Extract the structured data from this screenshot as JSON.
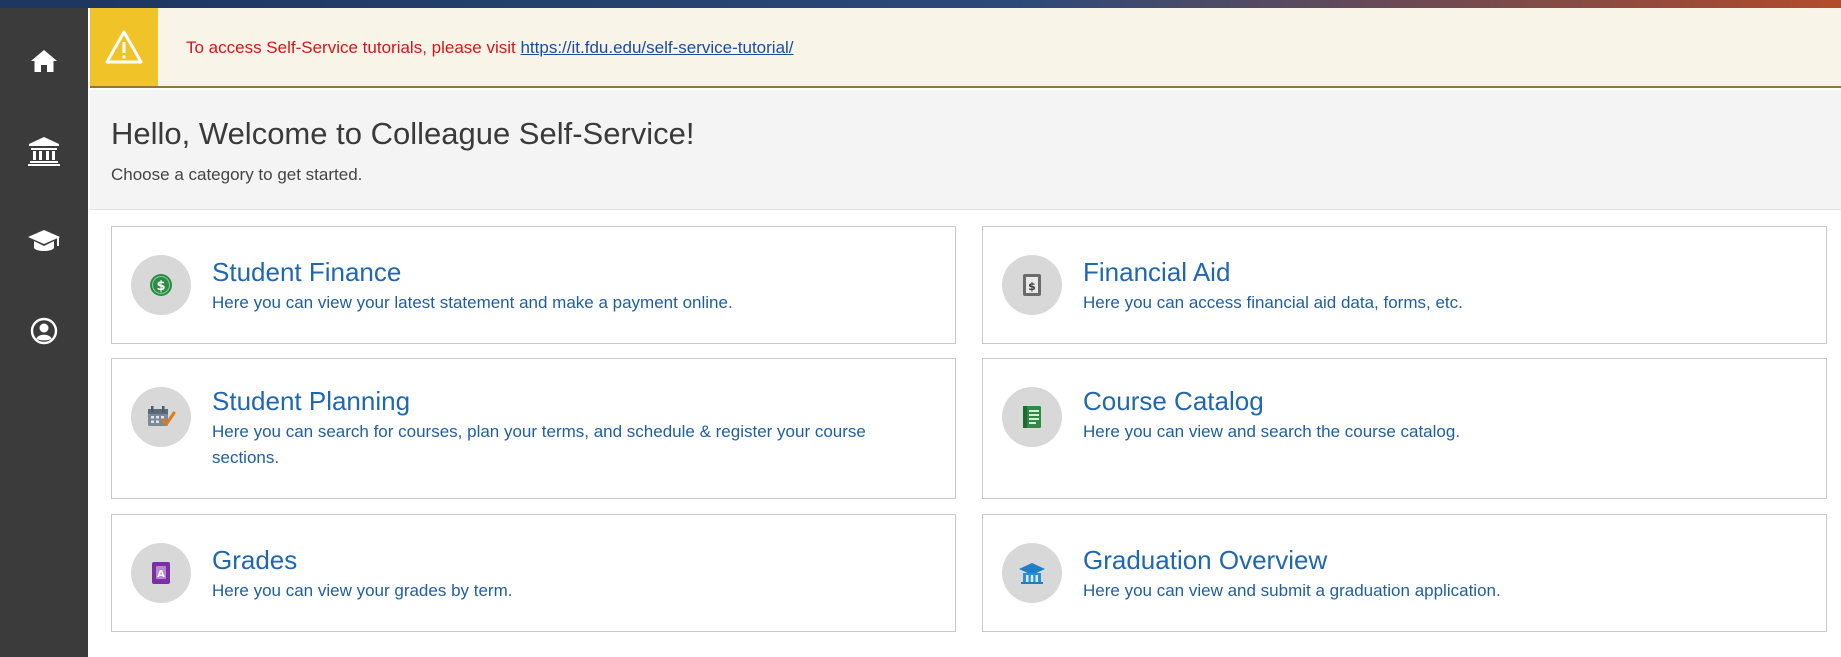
{
  "alert": {
    "message": "To access Self-Service tutorials, please visit ",
    "link_text": "https://it.fdu.edu/self-service-tutorial/",
    "icon": "warning-icon",
    "colors": {
      "background": "#f8f5e8",
      "icon_box": "#f0c428",
      "text": "#d4161a",
      "link": "#1a4d9c"
    }
  },
  "sidebar": {
    "items": [
      {
        "icon": "home-icon"
      },
      {
        "icon": "bank-icon"
      },
      {
        "icon": "graduation-cap-icon"
      },
      {
        "icon": "user-circle-icon"
      }
    ],
    "colors": {
      "background": "#3b3b3b",
      "icon": "#ffffff"
    }
  },
  "welcome": {
    "title": "Hello, Welcome to Colleague Self-Service!",
    "subtitle": "Choose a category to get started."
  },
  "categories": [
    {
      "title": "Student Finance",
      "description": "Here you can view your latest statement and make a payment online.",
      "icon": "dollar-coin-icon"
    },
    {
      "title": "Financial Aid",
      "description": "Here you can access financial aid data, forms, etc.",
      "icon": "money-document-icon"
    },
    {
      "title": "Student Planning",
      "description": "Here you can search for courses, plan your terms, and schedule & register your course sections.",
      "icon": "calendar-check-icon"
    },
    {
      "title": "Course Catalog",
      "description": "Here you can view and search the course catalog.",
      "icon": "catalog-book-icon"
    },
    {
      "title": "Grades",
      "description": "Here you can view your grades by term.",
      "icon": "grade-book-icon"
    },
    {
      "title": "Graduation Overview",
      "description": "Here you can view and submit a graduation application.",
      "icon": "graduation-building-icon"
    }
  ],
  "colors": {
    "card_title": "#1f67b1",
    "card_desc": "#1f5fa0",
    "card_border": "#c9c9c9",
    "icon_circle": "#d8d8d8"
  }
}
